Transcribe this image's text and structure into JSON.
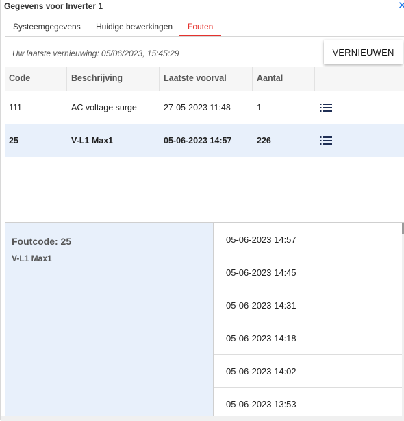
{
  "window": {
    "title": "Gegevens voor Inverter 1",
    "close_icon": "close-icon"
  },
  "tabs": [
    {
      "label": "Systeemgegevens",
      "active": false
    },
    {
      "label": "Huidige bewerkingen",
      "active": false
    },
    {
      "label": "Fouten",
      "active": true
    }
  ],
  "refresh": {
    "info": "Uw laatste vernieuwing: 05/06/2023, 15:45:29",
    "button_label": "VERNIEUWEN"
  },
  "table": {
    "headers": [
      "Code",
      "Beschrijving",
      "Laatste voorval",
      "Aantal",
      ""
    ],
    "rows": [
      {
        "code": "111",
        "description": "AC voltage surge",
        "last": "27-05-2023 11:48",
        "count": "1",
        "icon": "list-icon"
      },
      {
        "code": "25",
        "description": "V-L1 Max1",
        "last": "05-06-2023 14:57",
        "count": "226",
        "icon": "list-icon",
        "selected": true
      }
    ]
  },
  "detail": {
    "fault_code": "Foutcode: 25",
    "description": "V-L1 Max1",
    "occurrences": [
      "05-06-2023 14:57",
      "05-06-2023 14:45",
      "05-06-2023 14:31",
      "05-06-2023 14:18",
      "05-06-2023 14:02",
      "05-06-2023 13:53"
    ]
  },
  "colors": {
    "accent": "#e5322d",
    "selected_row": "#e8f0fb",
    "link": "#1a73e8"
  }
}
